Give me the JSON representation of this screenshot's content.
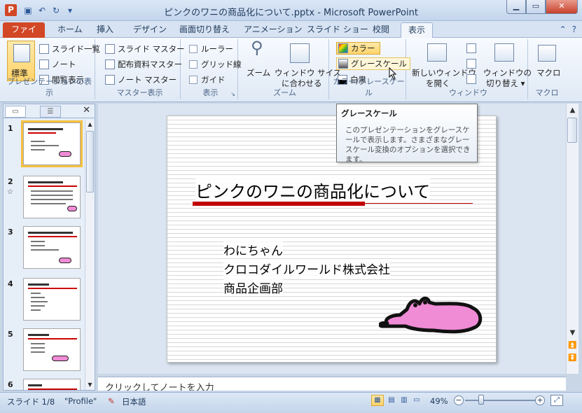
{
  "window": {
    "title": "ピンクのワニの商品化について.pptx - Microsoft PowerPoint",
    "app_letter": "P"
  },
  "tabs": [
    "ファイル",
    "ホーム",
    "挿入",
    "デザイン",
    "画面切り替え",
    "アニメーション",
    "スライド ショー",
    "校閲",
    "表示"
  ],
  "active_tab": "表示",
  "ribbon": {
    "pres_views": {
      "label": "プレゼンテーションの表示",
      "normal": "標準",
      "sorter": "スライド一覧",
      "notes": "ノート",
      "reading": "閲覧表示"
    },
    "master_views": {
      "label": "マスター表示",
      "slide_master": "スライド マスター",
      "handout_master": "配布資料マスター",
      "notes_master": "ノート マスター"
    },
    "show": {
      "label": "表示",
      "ruler": "ルーラー",
      "gridlines": "グリッド線",
      "guides": "ガイド"
    },
    "zoom": {
      "label": "ズーム",
      "zoom": "ズーム",
      "fit1": "ウィンドウ サイズ",
      "fit2": "に合わせる"
    },
    "color": {
      "label": "カラー/グレースケール",
      "color": "カラー",
      "grayscale": "グレースケール",
      "bw": "白黒"
    },
    "window": {
      "label": "ウィンドウ",
      "new1": "新しいウィンドウ",
      "new2": "を開く",
      "switch1": "ウィンドウの",
      "switch2": "切り替え"
    },
    "macros": {
      "label": "マクロ",
      "macros": "マクロ"
    }
  },
  "tooltip": {
    "title": "グレースケール",
    "body": "このプレゼンテーションをグレースケールで表示します。さまざまなグレースケール変換のオプションを選択できます。"
  },
  "slides": [
    {
      "num": "1"
    },
    {
      "num": "2"
    },
    {
      "num": "3"
    },
    {
      "num": "4"
    },
    {
      "num": "5"
    },
    {
      "num": "6"
    }
  ],
  "slide": {
    "title": "ピンクのワニの商品化について",
    "lines": [
      "わにちゃん",
      "クロコダイルワールド株式会社",
      "商品企画部"
    ]
  },
  "notes": {
    "placeholder": "クリックしてノートを入力"
  },
  "status": {
    "slide": "スライド 1/8",
    "theme": "\"Profile\"",
    "language": "日本語",
    "zoom": "49%"
  },
  "colors": {
    "file_tab": "#d24726",
    "croc_pink": "#f08bd6",
    "title_bar": "#c00000",
    "highlight": "#ffd36a"
  }
}
